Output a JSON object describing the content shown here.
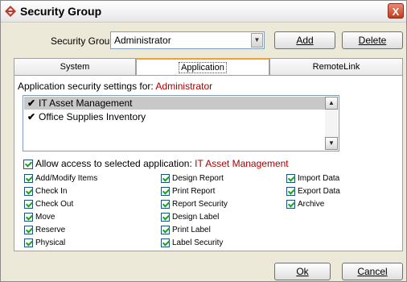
{
  "window": {
    "title": "Security Group",
    "close_label": "X"
  },
  "group": {
    "label": "Security Group",
    "value": "Administrator",
    "add_label": "Add",
    "delete_label": "Delete"
  },
  "tabs": [
    {
      "label": "System",
      "active": false
    },
    {
      "label": "Application",
      "active": true
    },
    {
      "label": "RemoteLink",
      "active": false
    }
  ],
  "app_panel": {
    "settings_prefix": "Application security settings for:",
    "settings_for": "Administrator",
    "applications": [
      {
        "name": "IT Asset Management",
        "checked": true,
        "selected": true
      },
      {
        "name": "Office Supplies Inventory",
        "checked": true,
        "selected": false
      }
    ],
    "allow_prefix": "Allow access to selected application:",
    "allow_app": "IT Asset Management",
    "allow_checked": true,
    "permissions": [
      [
        "Add/Modify Items",
        "Check In",
        "Check Out",
        "Move",
        "Reserve",
        "Physical"
      ],
      [
        "Design Report",
        "Print Report",
        "Report Security",
        "Design Label",
        "Print Label",
        "Label Security"
      ],
      [
        "Import Data",
        "Export Data",
        "Archive"
      ]
    ]
  },
  "footer": {
    "ok_label": "Ok",
    "cancel_label": "Cancel"
  },
  "colors": {
    "value_red": "#aa0000",
    "tab_accent": "#f0a030",
    "check_green": "#21a121"
  }
}
